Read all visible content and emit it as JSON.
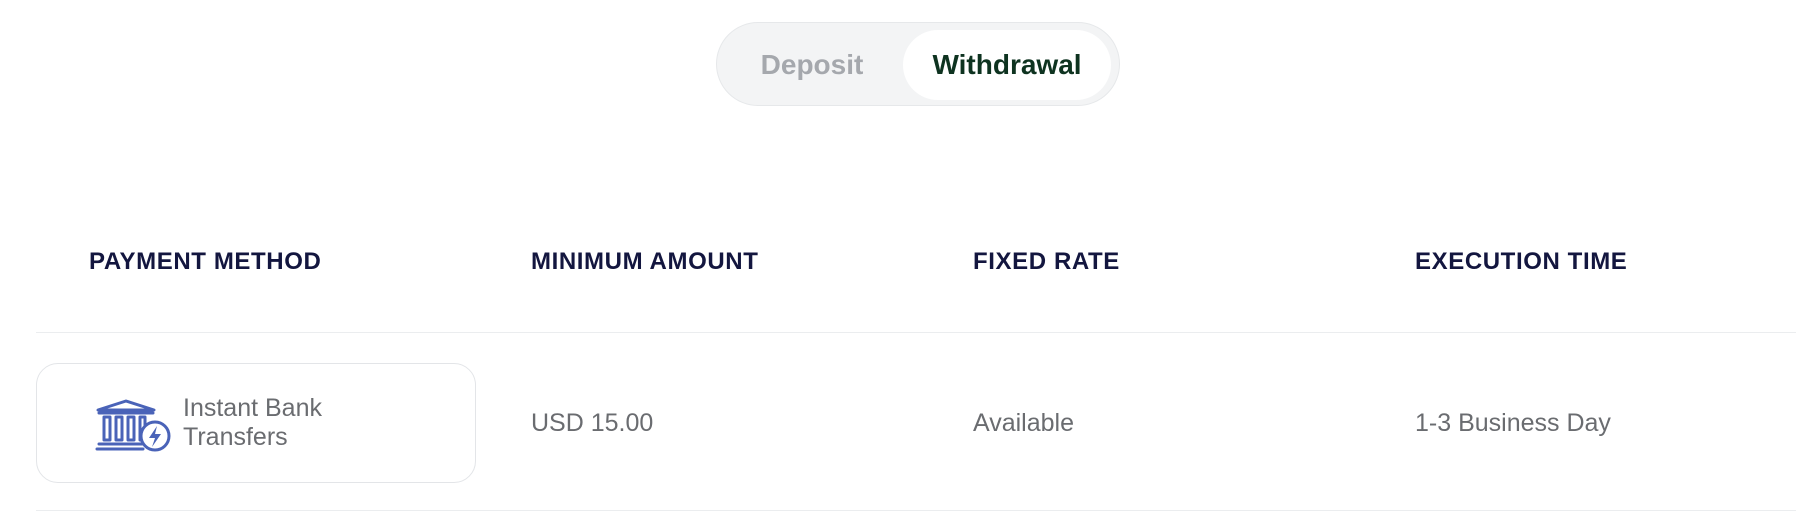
{
  "tabs": {
    "deposit_label": "Deposit",
    "withdrawal_label": "Withdrawal",
    "selected": "Withdrawal"
  },
  "table": {
    "headers": {
      "payment_method": "PAYMENT METHOD",
      "minimum_amount": "MINIMUM AMOUNT",
      "fixed_rate": "FIXED RATE",
      "execution_time": "EXECUTION TIME"
    },
    "rows": [
      {
        "method_icon": "instant-bank-icon",
        "method_name": "Instant Bank Transfers",
        "minimum_amount": "USD 15.00",
        "fixed_rate": "Available",
        "execution_time": "1-3 Business Day"
      }
    ]
  },
  "colors": {
    "header_text": "#13163f",
    "active_tab_text": "#0e3320",
    "inactive_tab_text": "#a5a8ad",
    "icon_blue": "#4a63b8",
    "body_text": "#6a6c70"
  }
}
